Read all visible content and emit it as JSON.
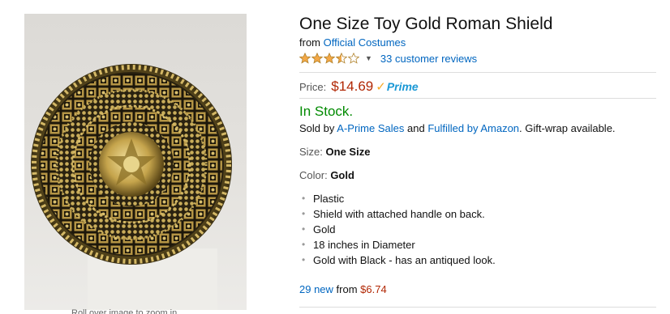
{
  "product": {
    "title": "One Size Toy Gold Roman Shield",
    "from_label": "from",
    "brand": "Official Costumes",
    "rating": 3.5,
    "rating_max": 5,
    "reviews_label": "33 customer reviews",
    "price_label": "Price:",
    "price": "$14.69",
    "prime_label": "Prime",
    "stock": "In Stock.",
    "sold_by_prefix": "Sold by",
    "seller": "A-Prime Sales",
    "sold_by_and": "and",
    "fulfilled_by": "Fulfilled by Amazon",
    "gift_wrap": ". Gift-wrap available.",
    "size_label": "Size:",
    "size_value": "One Size",
    "color_label": "Color:",
    "color_value": "Gold",
    "bullets": [
      "Plastic",
      "Shield with attached handle on back.",
      "Gold",
      "18 inches in Diameter",
      "Gold with Black - has an antiqued look."
    ],
    "offers_count": "29 new",
    "offers_from": "from",
    "offers_price": "$6.74"
  },
  "image": {
    "caption": "Roll over image to zoom in"
  },
  "icons": {
    "star": "star-icon",
    "dropdown": "chevron-down-icon",
    "prime": "prime-check-icon"
  },
  "colors": {
    "link": "#0066c0",
    "price": "#b12704",
    "in_stock": "#008a00",
    "star": "#f3a847",
    "prime_blue": "#1a98d5",
    "prime_check": "#f7a823"
  }
}
